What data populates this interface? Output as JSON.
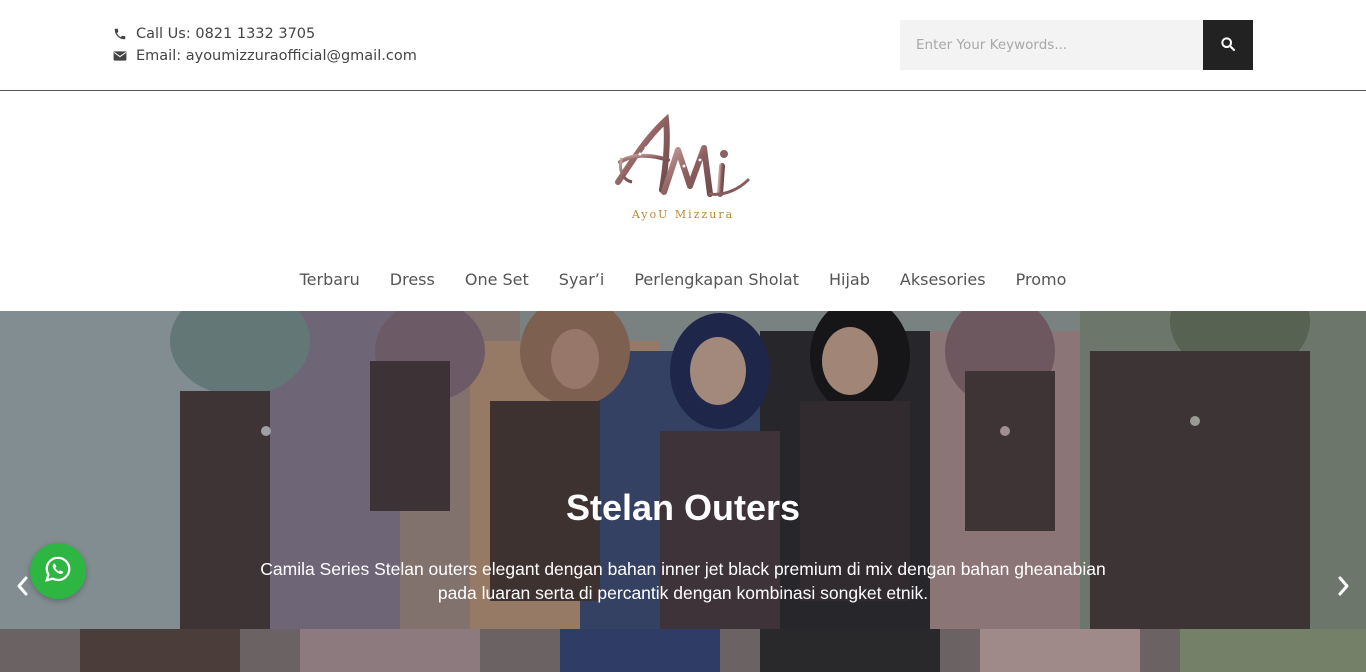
{
  "header": {
    "phone_label": "Call Us: 0821 1332 3705",
    "email_label": "Email: ayoumizzuraofficial@gmail.com",
    "search": {
      "placeholder": "Enter Your Keywords...",
      "value": ""
    }
  },
  "logo": {
    "monogram": "AMi",
    "tagline": "AyoU Mizzura"
  },
  "nav": {
    "items": [
      {
        "label": "Terbaru"
      },
      {
        "label": "Dress"
      },
      {
        "label": "One Set"
      },
      {
        "label": "Syar’i"
      },
      {
        "label": "Perlengkapan Sholat"
      },
      {
        "label": "Hijab"
      },
      {
        "label": "Aksesories"
      },
      {
        "label": "Promo"
      }
    ]
  },
  "hero": {
    "title": "Stelan Outers",
    "description": "Camila Series Stelan outers elegant dengan bahan inner jet black premium di mix dengan bahan gheanabian pada luaran serta di percantik dengan kombinasi songket etnik."
  },
  "icons": {
    "phone": "phone-icon",
    "email": "envelope-icon",
    "search": "search-icon",
    "prev": "chevron-left-icon",
    "next": "chevron-right-icon",
    "whatsapp": "whatsapp-icon"
  },
  "colors": {
    "search_button": "#222222",
    "whatsapp": "#2db742",
    "logo_gold": "#b58a3a",
    "logo_rose": "#9b6e6c"
  }
}
